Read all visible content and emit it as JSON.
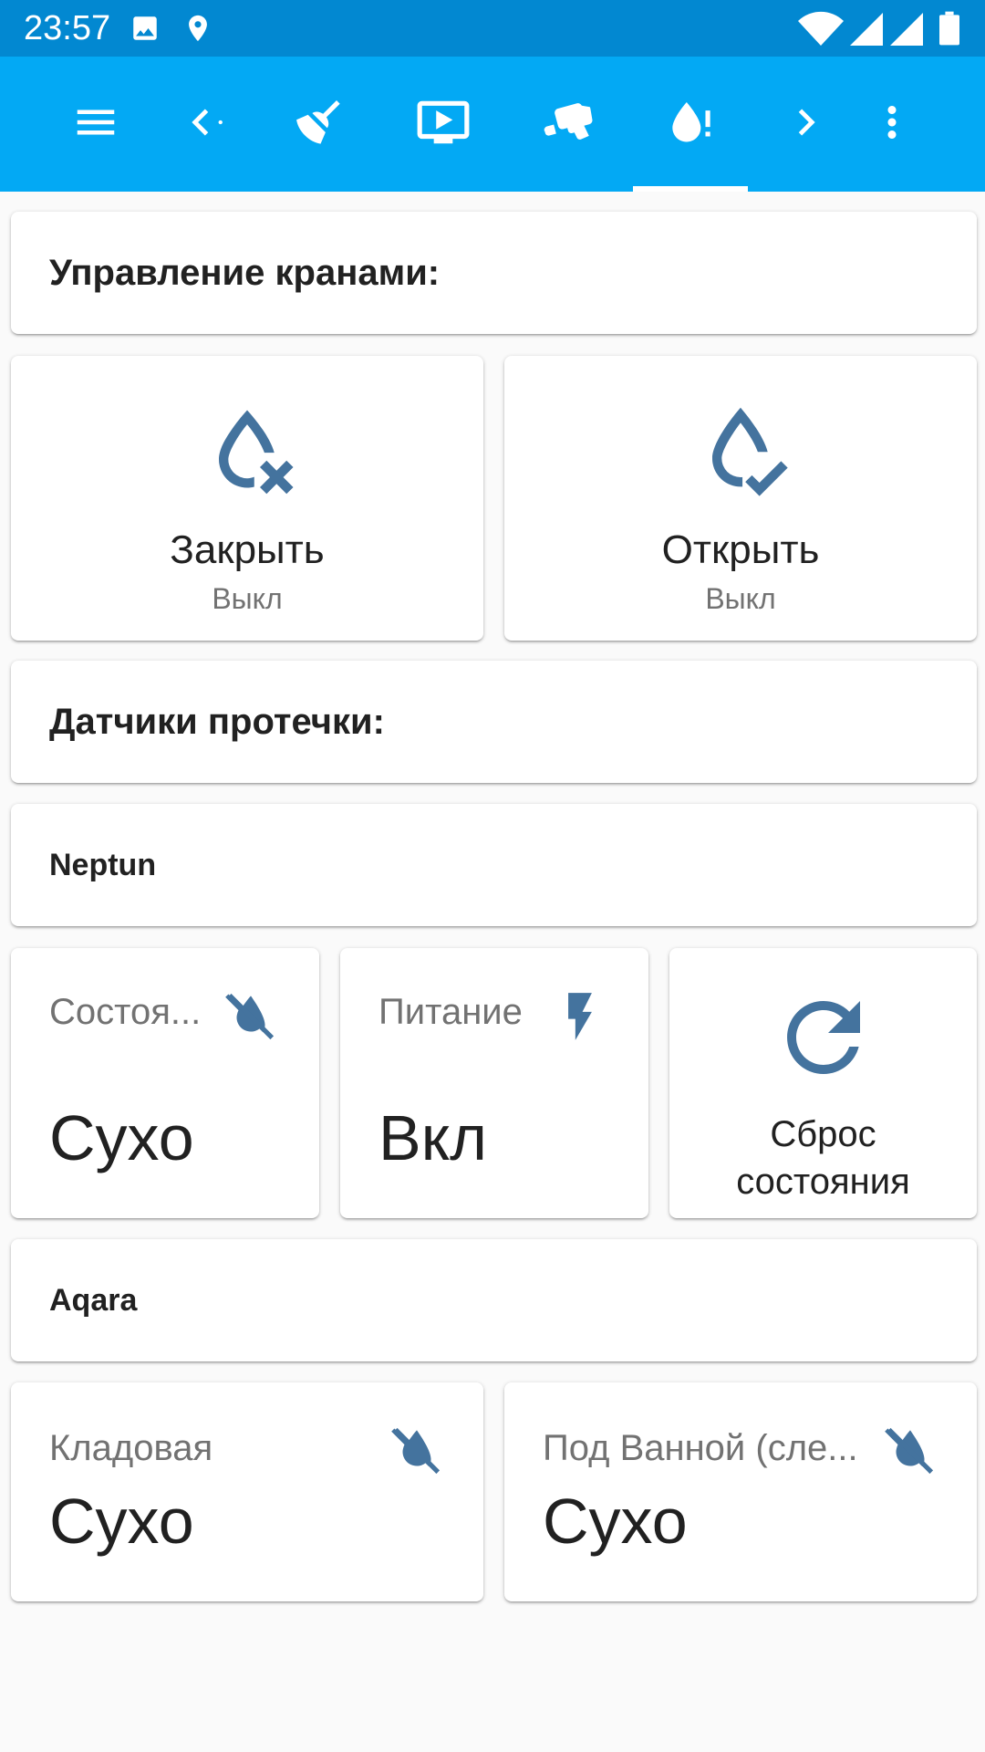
{
  "status_bar": {
    "time": "23:57",
    "icons": [
      "image-icon",
      "location-pin-icon",
      "wifi-icon",
      "signal-icon",
      "signal-icon",
      "battery-icon"
    ]
  },
  "colors": {
    "status_bar": "#0288d1",
    "toolbar": "#03a9f4",
    "icon_accent": "#44739e",
    "background": "#fafafa",
    "card": "#ffffff",
    "primary_text": "#212121",
    "secondary_text": "#727272"
  },
  "toolbar": {
    "items": [
      "menu-icon",
      "chevron-left-icon",
      "broom-icon",
      "monitor-play-icon",
      "cctv-icon",
      "water-alert-icon",
      "chevron-right-icon",
      "more-vert-icon"
    ],
    "active_item": "water-alert-icon"
  },
  "valves": {
    "header": "Управление кранами:",
    "close": {
      "name": "Закрыть",
      "state": "Выкл",
      "icon": "water-remove-icon"
    },
    "open": {
      "name": "Открыть",
      "state": "Выкл",
      "icon": "water-check-icon"
    }
  },
  "leak_sensors": {
    "header": "Датчики протечки:"
  },
  "neptun": {
    "header": "Neptun",
    "status": {
      "label": "Состоя...",
      "value": "Сухо",
      "icon": "water-off-icon"
    },
    "power": {
      "label": "Питание",
      "value": "Вкл",
      "icon": "flash-icon"
    },
    "reset": {
      "line1": "Сброс",
      "line2": "состояния",
      "icon": "refresh-icon"
    }
  },
  "aqara": {
    "header": "Aqara",
    "pantry": {
      "label": "Кладовая",
      "value": "Сухо",
      "icon": "water-off-icon"
    },
    "bathroom": {
      "label": "Под Ванной (сле...",
      "value": "Сухо",
      "icon": "water-off-icon"
    }
  }
}
